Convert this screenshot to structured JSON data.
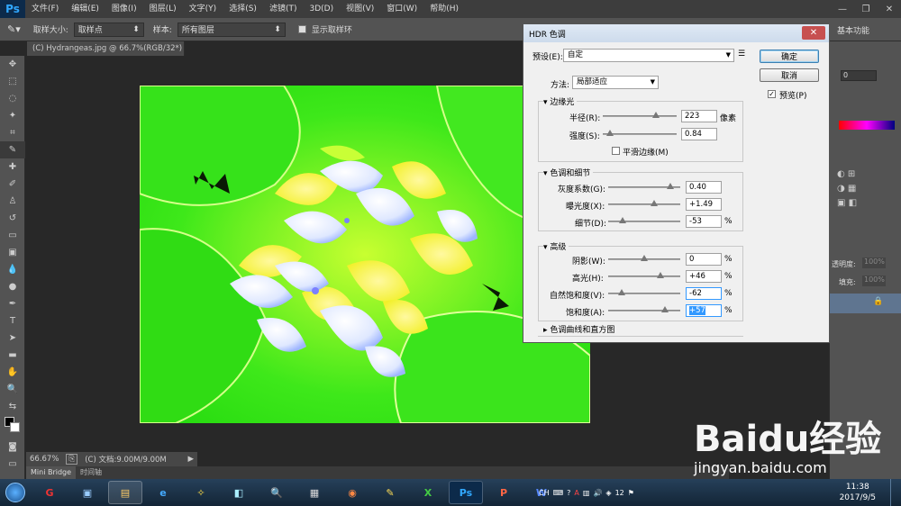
{
  "menubar": {
    "logo": "Ps",
    "items": [
      "文件(F)",
      "编辑(E)",
      "图像(I)",
      "图层(L)",
      "文字(Y)",
      "选择(S)",
      "滤镜(T)",
      "3D(D)",
      "视图(V)",
      "窗口(W)",
      "帮助(H)"
    ]
  },
  "options": {
    "size_label": "取样大小:",
    "size_value": "取样点",
    "sample_label": "样本:",
    "sample_value": "所有图层",
    "show_ring": "显示取样环",
    "workspace": "基本功能"
  },
  "document_tab": "(C) Hydrangeas.jpg @ 66.7%(RGB/32*) *",
  "status": {
    "zoom": "66.67%",
    "doc": "(C) 文档:9.00M/9.00M"
  },
  "bottom_tabs": [
    "Mini Bridge",
    "时间轴"
  ],
  "right_panel": {
    "opacity_label": "透明度:",
    "opacity_value": "100%",
    "fill_label": "填充:",
    "fill_value": "100%",
    "val0": "0"
  },
  "dialog": {
    "title": "HDR 色调",
    "preset_label": "预设(E):",
    "preset_value": "自定",
    "ok": "确定",
    "cancel": "取消",
    "preview": "预览(P)",
    "method_label": "方法:",
    "method_value": "局部适应",
    "edge_glow": {
      "title": "边缘光",
      "radius_label": "半径(R):",
      "radius_value": "223",
      "radius_unit": "像素",
      "radius": 0.72,
      "strength_label": "强度(S):",
      "strength_value": "0.84",
      "strength": 0.1,
      "smooth_label": "平滑边缘(M)"
    },
    "tone_detail": {
      "title": "色调和细节",
      "gamma_label": "灰度系数(G):",
      "gamma_value": "0.40",
      "gamma": 0.86,
      "exposure_label": "曝光度(X):",
      "exposure_value": "+1.49",
      "exposure": 0.64,
      "detail_label": "细节(D):",
      "detail_value": "-53",
      "detail": 0.2
    },
    "advanced": {
      "title": "高级",
      "shadow_label": "阴影(W):",
      "shadow_value": "0",
      "shadow": 0.5,
      "highlight_label": "高光(H):",
      "highlight_value": "+46",
      "highlight": 0.73,
      "vibrance_label": "自然饱和度(V):",
      "vibrance_value": "-62",
      "vibrance": 0.19,
      "saturation_label": "饱和度(A):",
      "saturation_value": "+57",
      "saturation": 0.79
    },
    "curve": "色调曲线和直方图",
    "percent": "%"
  },
  "taskbar": {
    "tray": [
      "CH",
      "12"
    ],
    "time": "11:38",
    "date": "2017/9/5"
  },
  "watermark": {
    "line1": "Baidu经验",
    "line2": "jingyan.baidu.com"
  }
}
